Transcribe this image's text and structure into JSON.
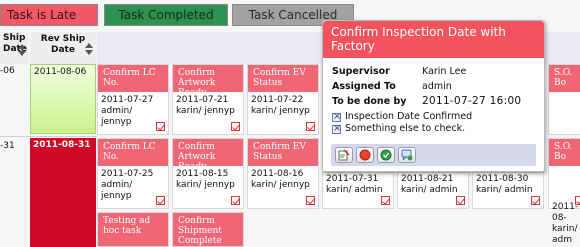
{
  "legend": {
    "late": "Task is Late",
    "completed": "Task Completed",
    "cancelled": "Task Cancelled"
  },
  "colors": {
    "late": "#f05a66",
    "completed": "#2e9150",
    "cancelled": "#a2a2a2",
    "overdue_date": "#d00a26",
    "on_track_date": "#c9f28c"
  },
  "columns": {
    "ship_date": "Ship Date",
    "rev_ship_date": "Rev Ship Date"
  },
  "rows": [
    {
      "ship_date": "-06",
      "rev_ship_date": "2011-08-06",
      "cards": [
        {
          "title": "Confirm LC No.",
          "date": "2011-07-27",
          "users": "admin/ jennyp"
        },
        {
          "title": "Confirm Artwork Ready",
          "date": "2011-07-21",
          "users": "karin/ jennyp"
        },
        {
          "title": "Confirm EV Status",
          "date": "2011-07-22",
          "users": "karin/ jennyp"
        }
      ]
    },
    {
      "ship_date": "-31",
      "rev_ship_date": "2011-08-31",
      "cards": [
        {
          "title": "Confirm LC No.",
          "date": "2011-07-25",
          "users": "admin/ jennyp"
        },
        {
          "title": "Confirm Artwork Ready",
          "date": "2011-08-15",
          "users": "karin/ jennyp"
        },
        {
          "title": "Confirm EV Status",
          "date": "2011-08-16",
          "users": "karin/ jennyp"
        },
        {
          "title": "",
          "date": "2011-07-31",
          "users": "karin/ admin"
        },
        {
          "title": "",
          "date": "2011-08-21",
          "users": "karin/ admin"
        },
        {
          "title": "",
          "date": "2011-08-30",
          "users": "karin/ admin"
        },
        {
          "title": "",
          "date": "2011-08-",
          "users": "karin/ adm"
        }
      ],
      "extra_cards": [
        {
          "title": "Testing ad hoc task"
        },
        {
          "title": "Confirm Shipment Complete Status"
        }
      ]
    }
  ],
  "row1_partial_title": "S.O. Bo",
  "row2_partial_title": "S.O. Bo",
  "popup": {
    "title": "Confirm Inspection Date with Factory",
    "supervisor_label": "Supervisor",
    "supervisor": "Karin Lee",
    "assigned_label": "Assigned To",
    "assigned": "admin",
    "due_label": "To be done by",
    "due": "2011-07-27 16:00",
    "checks": [
      "Inspection Date Confirmed",
      "Something else to check."
    ],
    "toolbar_icons": [
      "edit-note-icon",
      "record-icon",
      "check-circle-icon",
      "comment-add-icon"
    ]
  }
}
